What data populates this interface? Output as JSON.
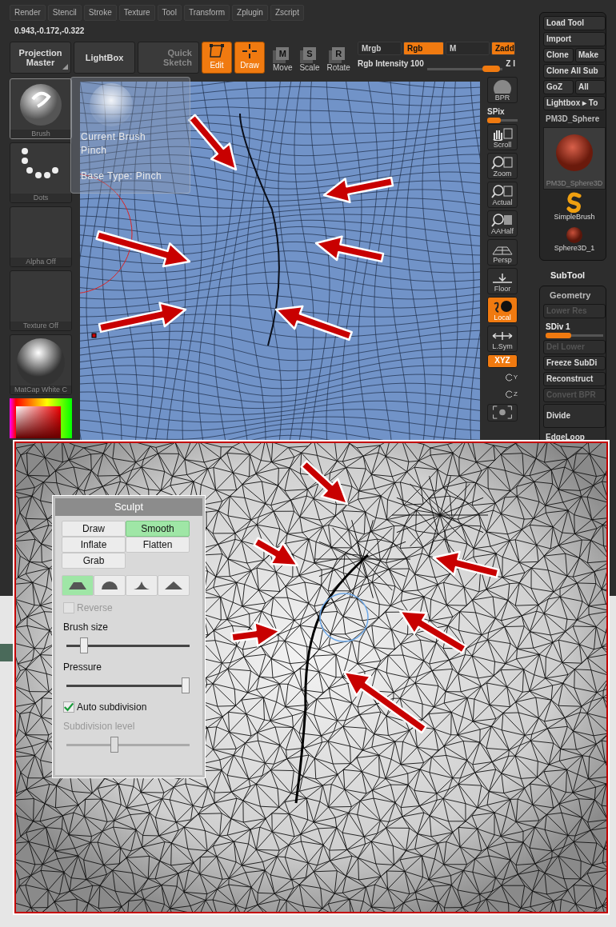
{
  "menu": [
    "Render",
    "Stencil",
    "Stroke",
    "Texture",
    "Tool",
    "Transform",
    "Zplugin",
    "Zscript"
  ],
  "coordinates": "0.943,-0.172,-0.322",
  "toolbar": [
    {
      "label": "Projection Master",
      "kind": "wide",
      "active": false
    },
    {
      "label": "LightBox",
      "kind": "wide",
      "active": false
    },
    {
      "label": "Quick Sketch",
      "kind": "sketch",
      "active": false
    },
    {
      "label": "Edit",
      "kind": "edit",
      "active": true
    },
    {
      "label": "Draw",
      "kind": "draw",
      "active": true
    },
    {
      "label": "Move",
      "kind": "letter",
      "glyph": "M",
      "active": false
    },
    {
      "label": "Scale",
      "kind": "letter",
      "glyph": "S",
      "active": false
    },
    {
      "label": "Rotate",
      "kind": "letter",
      "glyph": "R",
      "active": false
    }
  ],
  "color_modes": [
    {
      "label": "Mrgb",
      "active": false
    },
    {
      "label": "Rgb",
      "active": true
    },
    {
      "label": "M",
      "active": false
    },
    {
      "label": "Zadd",
      "active": true
    }
  ],
  "intensity": {
    "label": "Rgb Intensity 100",
    "level": 0.95
  },
  "z_intensity": "Z I",
  "left_tiles": [
    {
      "label": "Brush",
      "kind": "brush"
    },
    {
      "label": "Dots",
      "kind": "dots"
    },
    {
      "label": "Alpha Off",
      "kind": "empty"
    },
    {
      "label": "Texture Off",
      "kind": "empty"
    },
    {
      "label": "MatCap White C",
      "kind": "matcap"
    }
  ],
  "tooltip": {
    "title": "Current Brush",
    "brush": "Pinch",
    "base_type": "Base Type: Pinch"
  },
  "shelf": [
    {
      "label": "BPR",
      "kind": "bpr",
      "active": false
    },
    {
      "label": "SPix",
      "kind": "slider",
      "level": 0.45
    },
    {
      "label": "Scroll",
      "kind": "scroll",
      "active": false
    },
    {
      "label": "Zoom",
      "kind": "zoom",
      "active": false
    },
    {
      "label": "Actual",
      "kind": "actual",
      "active": false
    },
    {
      "label": "AAHalf",
      "kind": "aahalf",
      "active": false
    },
    {
      "label": "Persp",
      "kind": "persp",
      "active": false
    },
    {
      "label": "Floor",
      "kind": "floor",
      "active": false
    },
    {
      "label": "Local",
      "kind": "local",
      "active": true
    },
    {
      "label": "L.Sym",
      "kind": "lsym",
      "active": false
    },
    {
      "label": "XYZ",
      "kind": "xyz",
      "active": true
    },
    {
      "label": "Y",
      "kind": "rot",
      "active": false
    },
    {
      "label": "Z",
      "kind": "rot",
      "active": false
    },
    {
      "kind": "frame",
      "active": false
    }
  ],
  "tool_panel": {
    "rows": [
      [
        "Load Tool"
      ],
      [
        "Import"
      ],
      [
        "Clone",
        "Make"
      ],
      [
        "Clone All Sub"
      ],
      [
        "GoZ",
        "All"
      ],
      [
        "Lightbox ▸ To"
      ]
    ],
    "current_tool": "PM3D_Sphere",
    "thumbnails": [
      {
        "label": "PM3D_Sphere3D",
        "kind": "large"
      },
      {
        "label": "SimpleBrush",
        "kind": "brush"
      },
      {
        "label": "Sphere3D_1",
        "kind": "small"
      }
    ]
  },
  "subtool": "SubTool",
  "geometry": {
    "title": "Geometry",
    "items": [
      {
        "label": "Lower Res",
        "kind": "button",
        "disabled": true
      },
      {
        "label": "SDiv 1",
        "kind": "slider",
        "level": 0.45
      },
      {
        "label": "Del Lower",
        "kind": "button",
        "disabled": true
      },
      {
        "label": "Freeze SubDi",
        "kind": "button",
        "disabled": false
      },
      {
        "label": "Reconstruct",
        "kind": "button",
        "disabled": false
      },
      {
        "label": "Convert BPR",
        "kind": "button",
        "disabled": true
      },
      {
        "label": "Divide",
        "kind": "big",
        "disabled": false
      },
      {
        "label": "EdgeLoop",
        "kind": "header"
      }
    ]
  },
  "sculpt_panel": {
    "title": "Sculpt",
    "brushes": [
      {
        "label": "Draw",
        "selected": false
      },
      {
        "label": "Smooth",
        "selected": true
      },
      {
        "label": "Inflate",
        "selected": false
      },
      {
        "label": "Flatten",
        "selected": false
      },
      {
        "label": "Grab",
        "selected": false
      }
    ],
    "shapes": [
      {
        "kind": "flat",
        "selected": true
      },
      {
        "kind": "round",
        "selected": false
      },
      {
        "kind": "sharp",
        "selected": false
      },
      {
        "kind": "peak",
        "selected": false
      }
    ],
    "controls": [
      {
        "kind": "checkbox",
        "label": "Reverse",
        "checked": false,
        "disabled": true
      },
      {
        "kind": "slider",
        "label": "Brush size",
        "level": 0.12,
        "disabled": false
      },
      {
        "kind": "slider",
        "label": "Pressure",
        "level": 1.0,
        "disabled": false
      },
      {
        "kind": "checkbox",
        "label": "Auto subdivision",
        "checked": true,
        "disabled": false
      },
      {
        "kind": "slider",
        "label": "Subdivision level",
        "level": 0.38,
        "disabled": true
      }
    ]
  }
}
